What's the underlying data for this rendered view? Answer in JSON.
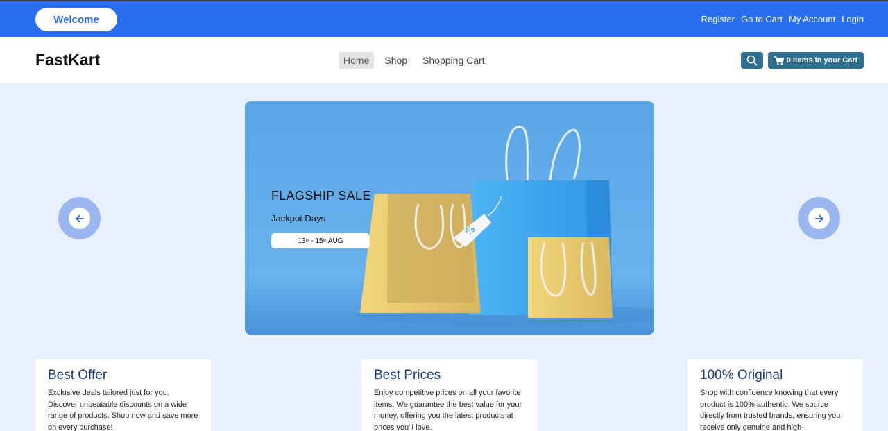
{
  "topbar": {
    "welcome_label": "Welcome",
    "links": [
      "Register",
      "Go to Cart",
      "My Account",
      "Login"
    ]
  },
  "navbar": {
    "brand": "FastKart",
    "menu": [
      "Home",
      "Shop",
      "Shopping Cart"
    ],
    "active_menu": "Home",
    "search_icon": "search-icon",
    "cart_label": "0 Items in your Cart",
    "cart_icon": "shopping-cart-icon"
  },
  "banner": {
    "title": "FLAGSHIP SALE",
    "subtitle": "Jackpot Days",
    "date_start": "13",
    "date_start_sup": "th",
    "date_sep": " - ",
    "date_end": "15",
    "date_end_sup": "th",
    "date_month": " AUG",
    "prev_icon": "arrow-left-icon",
    "next_icon": "arrow-right-icon"
  },
  "features": [
    {
      "title": "Best Offer",
      "text": "Exclusive deals tailored just for you. Discover unbeatable discounts on a wide range of products. Shop now and save more on every purchase!"
    },
    {
      "title": "Best Prices",
      "text": "Enjoy competitive prices on all your favorite items. We guarantee the best value for your money, offering you the latest products at prices you'll love."
    },
    {
      "title": "100% Original",
      "text": "Shop with confidence knowing that every product is 100% authentic. We source directly from trusted brands, ensuring you receive only genuine and high-"
    }
  ],
  "colors": {
    "topbar": "#2a6ef0",
    "page_bg": "#e7f0fd",
    "button": "#2e6e8e",
    "feature_title": "#1c3f79"
  }
}
